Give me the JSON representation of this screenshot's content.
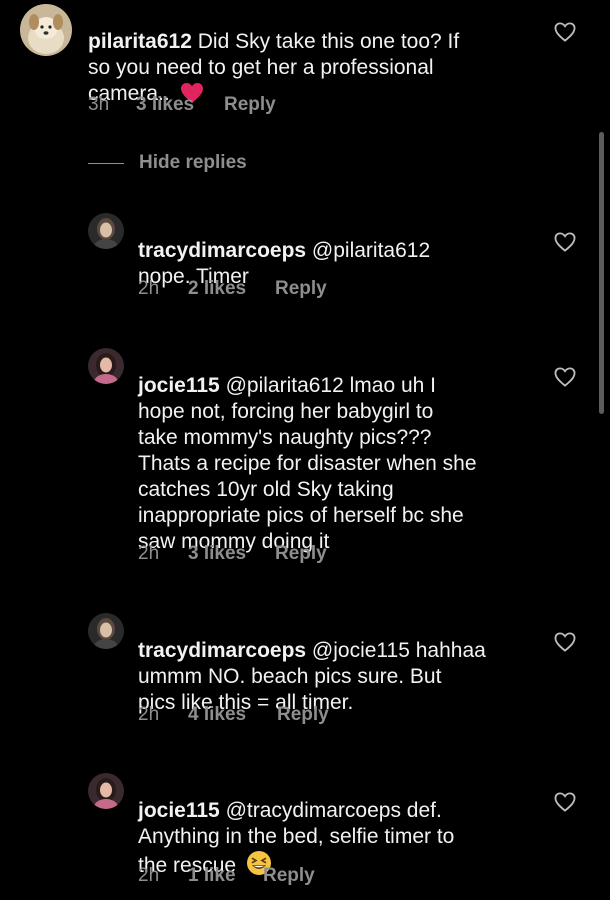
{
  "hide_replies_label": "Hide replies",
  "icons": {
    "like": "heart-outline-icon",
    "inline_emoji_heart": "red-heart-emoji",
    "inline_emoji_grin": "grinning-squinting-face-emoji"
  },
  "colors": {
    "background": "#000000",
    "text": "#f2f2f2",
    "secondary": "#8e8e8e",
    "heart_emoji": "#e0245e",
    "grin_emoji": "#f5c542"
  },
  "comments": [
    {
      "username": "pilarita612",
      "body": " Did Sky take this one too? If\nso you need to get her a professional\ncamera.. ",
      "time": "3h",
      "likes": "3 likes",
      "reply": "Reply"
    },
    {
      "username": "tracydimarcoeps",
      "body": " @pilarita612\nnope. Timer",
      "time": "2h",
      "likes": "2 likes",
      "reply": "Reply"
    },
    {
      "username": "jocie115",
      "body": " @pilarita612 lmao uh I\nhope not, forcing her babygirl to\ntake mommy's naughty pics???\nThats a recipe for disaster when she\ncatches 10yr old Sky taking\ninappropriate pics of herself bc she\nsaw mommy doing it",
      "time": "2h",
      "likes": "3 likes",
      "reply": "Reply"
    },
    {
      "username": "tracydimarcoeps",
      "body": " @jocie115 hahhaa\nummm NO. beach pics sure. But\npics like this = all timer.",
      "time": "2h",
      "likes": "4 likes",
      "reply": "Reply"
    },
    {
      "username": "jocie115",
      "body": " @tracydimarcoeps def.\nAnything in the bed, selfie timer to\nthe rescue ",
      "time": "2h",
      "likes": "1 like",
      "reply": "Reply"
    }
  ]
}
